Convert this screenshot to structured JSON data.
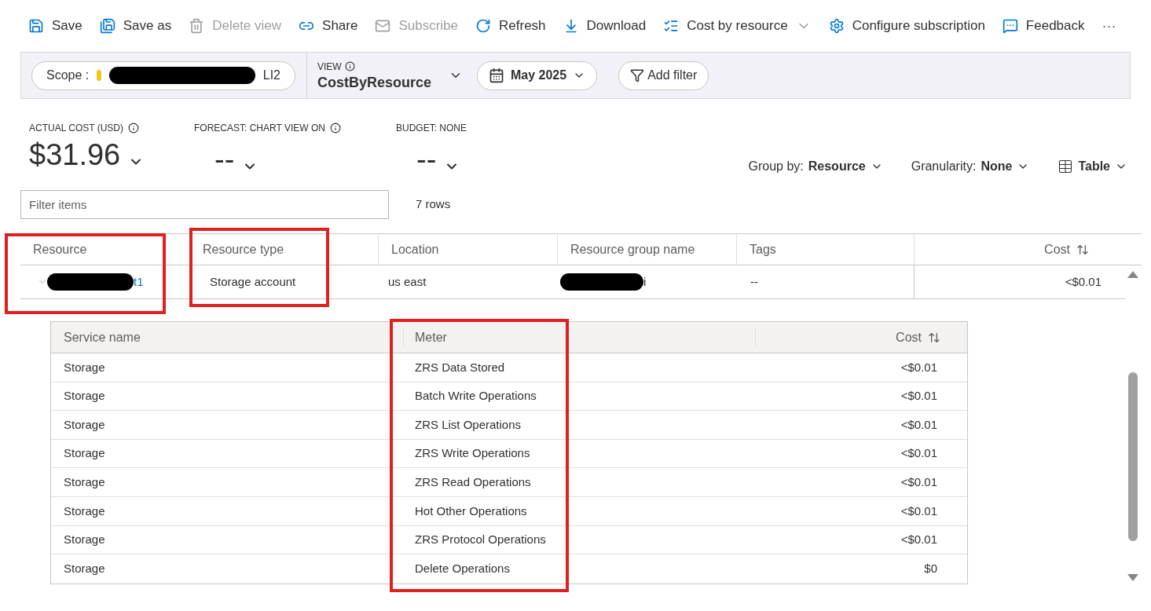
{
  "toolbar": [
    {
      "kind": "save",
      "label": "Save",
      "disabled": false
    },
    {
      "kind": "save-as",
      "label": "Save as",
      "disabled": false
    },
    {
      "kind": "delete",
      "label": "Delete view",
      "disabled": true
    },
    {
      "kind": "share",
      "label": "Share",
      "disabled": false
    },
    {
      "kind": "subscribe",
      "label": "Subscribe",
      "disabled": true
    },
    {
      "kind": "refresh",
      "label": "Refresh",
      "disabled": false
    },
    {
      "kind": "download",
      "label": "Download",
      "disabled": false
    },
    {
      "kind": "list",
      "label": "Cost by resource",
      "disabled": false
    },
    {
      "kind": "gear",
      "label": "Configure subscription",
      "disabled": false
    },
    {
      "kind": "feedback",
      "label": "Feedback",
      "disabled": false
    }
  ],
  "more": "···",
  "filter_bar": {
    "scope_label": "Scope :",
    "scope_value_tail": "LI2",
    "view_label": "VIEW",
    "view_name": "CostByResource",
    "date": "May 2025",
    "add_filter": "Add filter"
  },
  "summary": [
    {
      "label": "ACTUAL COST (USD)",
      "value": "$31.96",
      "info": true
    },
    {
      "label": "FORECAST: CHART VIEW ON",
      "value": "--",
      "info": true
    },
    {
      "label": "BUDGET: NONE",
      "value": "--",
      "info": false
    }
  ],
  "options": [
    {
      "label": "Group by:",
      "value": "Resource"
    },
    {
      "label": "Granularity:",
      "value": "None"
    },
    {
      "value": "Table"
    }
  ],
  "filter": {
    "placeholder": "Filter items"
  },
  "row_count": "7 rows",
  "table": {
    "columns": [
      "Resource",
      "Resource type",
      "Location",
      "Resource group name",
      "Tags",
      "Cost"
    ],
    "rows": [
      {
        "resource_tail": "t1",
        "type": "Storage account",
        "location": "us east",
        "group_tail": "i",
        "tags": "--",
        "cost": "<$0.01",
        "expanded": true
      }
    ]
  },
  "detail": {
    "columns": [
      "Service name",
      "Meter",
      "Cost"
    ],
    "rows": [
      [
        "Storage",
        "ZRS Data Stored",
        "<$0.01"
      ],
      [
        "Storage",
        "Batch Write Operations",
        "<$0.01"
      ],
      [
        "Storage",
        "ZRS List Operations",
        "<$0.01"
      ],
      [
        "Storage",
        "ZRS Write Operations",
        "<$0.01"
      ],
      [
        "Storage",
        "ZRS Read Operations",
        "<$0.01"
      ],
      [
        "Storage",
        "Hot Other Operations",
        "<$0.01"
      ],
      [
        "Storage",
        "ZRS Protocol Operations",
        "<$0.01"
      ],
      [
        "Storage",
        "Delete Operations",
        "$0"
      ]
    ]
  }
}
